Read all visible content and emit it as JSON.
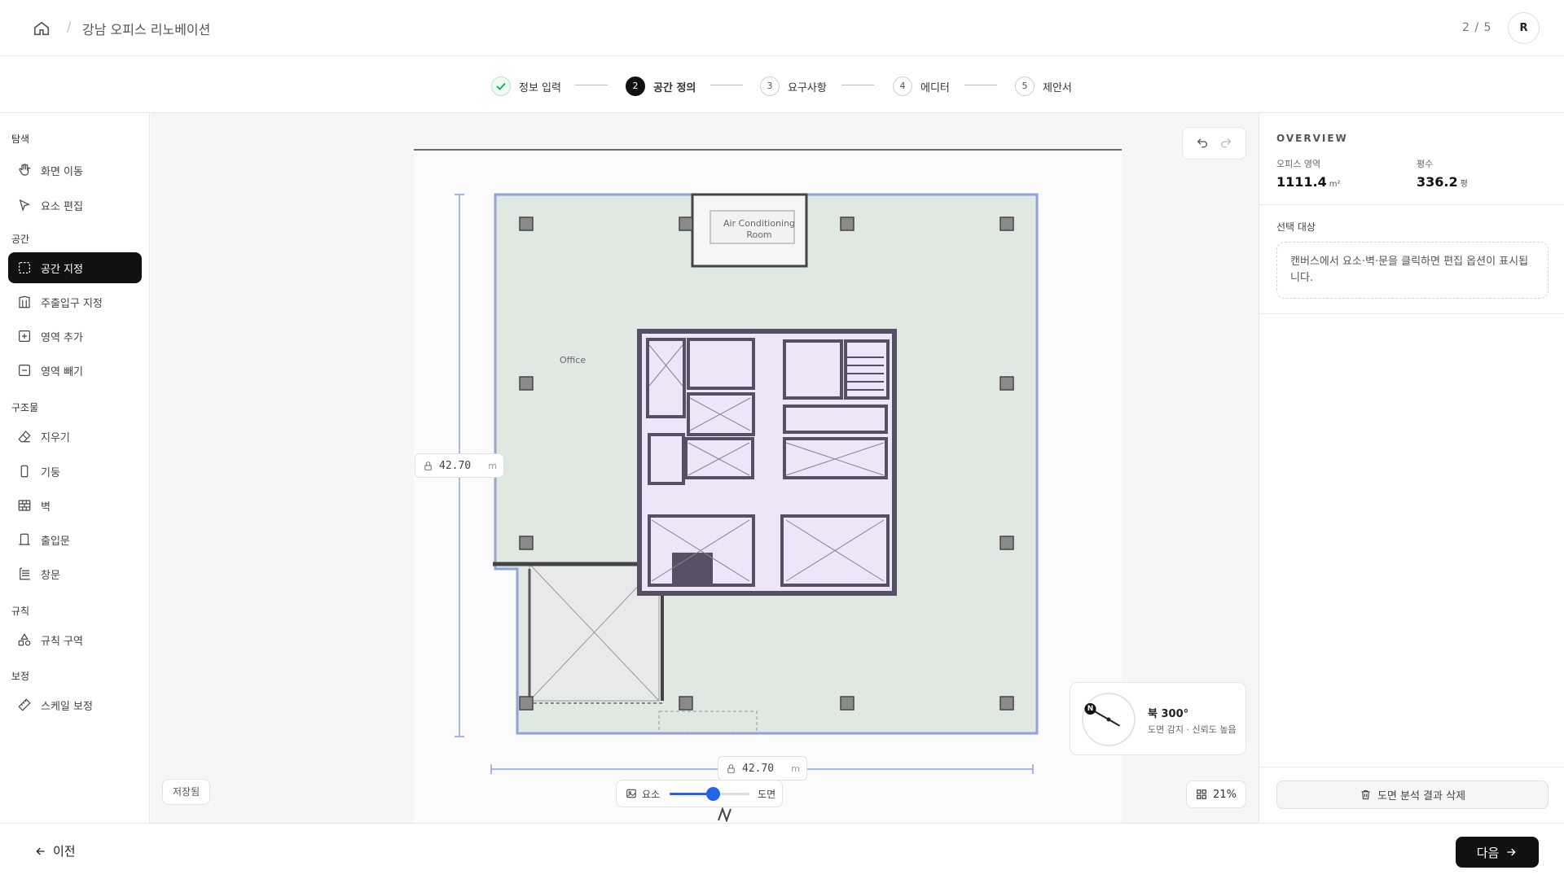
{
  "header": {
    "title": "강남 오피스 리노베이션",
    "page_count": "2 / 5",
    "avatar": "R"
  },
  "stepper": {
    "steps": [
      {
        "num": "✓",
        "label": "정보 입력",
        "state": "done"
      },
      {
        "num": "2",
        "label": "공간 정의",
        "state": "active"
      },
      {
        "num": "3",
        "label": "요구사항",
        "state": "pending"
      },
      {
        "num": "4",
        "label": "에디터",
        "state": "pending"
      },
      {
        "num": "5",
        "label": "제안서",
        "state": "pending"
      }
    ]
  },
  "sidebar": {
    "groups": [
      {
        "title": "탐색",
        "items": [
          {
            "label": "화면 이동",
            "icon": "hand-icon"
          },
          {
            "label": "요소 편집",
            "icon": "pointer-icon"
          }
        ]
      },
      {
        "title": "공간",
        "items": [
          {
            "label": "공간 지정",
            "icon": "select-area-icon",
            "active": true
          },
          {
            "label": "주출입구 지정",
            "icon": "entrance-icon"
          },
          {
            "label": "영역 추가",
            "icon": "plus-square-icon"
          },
          {
            "label": "영역 빼기",
            "icon": "minus-square-icon"
          }
        ]
      },
      {
        "title": "구조물",
        "items": [
          {
            "label": "지우기",
            "icon": "eraser-icon"
          },
          {
            "label": "기둥",
            "icon": "column-icon"
          },
          {
            "label": "벽",
            "icon": "wall-icon"
          },
          {
            "label": "출입문",
            "icon": "door-icon"
          },
          {
            "label": "창문",
            "icon": "window-icon"
          }
        ]
      },
      {
        "title": "규칙",
        "items": [
          {
            "label": "규칙 구역",
            "icon": "shapes-icon"
          }
        ]
      },
      {
        "title": "보정",
        "items": [
          {
            "label": "스케일 보정",
            "icon": "ruler-icon"
          }
        ]
      }
    ]
  },
  "canvas": {
    "floorplan_labels": {
      "ac_room_line1": "Air Conditioning",
      "ac_room_line2": "Room",
      "office": "Office"
    },
    "dim_vertical": {
      "value": "42.70",
      "unit": "m"
    },
    "dim_horizontal": {
      "value": "42.70",
      "unit": "m"
    },
    "compass": {
      "direction": "북 300°",
      "status": "도면 감지 · 신뢰도 높음",
      "badge": "N",
      "angle_deg": 300
    },
    "saved_label": "저장됨",
    "opacity": {
      "left_label": "요소",
      "right_label": "도면",
      "value": 0.55
    },
    "zoom": "21%"
  },
  "right_panel": {
    "overview_title": "OVERVIEW",
    "office_area_label": "오피스 영역",
    "office_area_value": "1111.4",
    "office_area_unit": "m²",
    "pyeong_label": "평수",
    "pyeong_value": "336.2",
    "pyeong_unit": "평",
    "selection_title": "선택 대상",
    "selection_hint": "캔버스에서 요소·벽·문을 클릭하면 편집 옵션이 표시됩니다.",
    "delete_label": "도면 분석 결과 삭제"
  },
  "footer": {
    "prev_label": "이전",
    "next_label": "다음"
  },
  "colors": {
    "accent": "#111111",
    "floor_fill": "#dfe8e1",
    "core_fill": "#ece6f7",
    "selection": "#8ea2e0"
  }
}
